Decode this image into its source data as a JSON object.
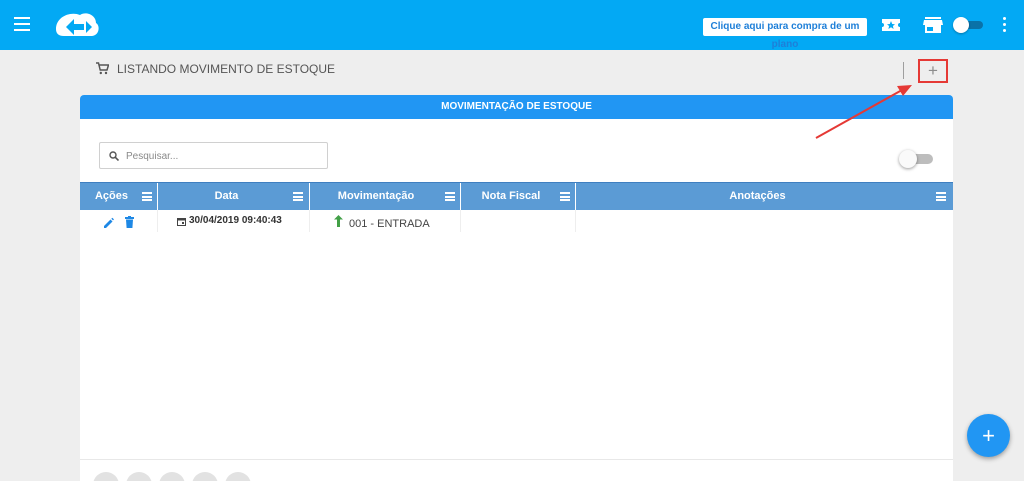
{
  "topbar": {
    "plan_button_label": "Clique aqui para compra de um plano",
    "icons": [
      "menu-icon",
      "logo",
      "ticket-icon",
      "store-icon",
      "toggle",
      "more-vert-icon"
    ],
    "accent_color": "#03a9f4"
  },
  "page": {
    "title": "LISTANDO MOVIMENTO DE ESTOQUE",
    "add_label": "+"
  },
  "card": {
    "header": "MOVIMENTAÇÃO DE ESTOQUE",
    "header_color": "#2196f3",
    "search": {
      "placeholder": "Pesquisar..."
    },
    "toggle_on": false
  },
  "table": {
    "columns": [
      "Ações",
      "Data",
      "Movimentação",
      "Nota Fiscal",
      "Anotações"
    ],
    "rows": [
      {
        "actions": [
          "edit-icon",
          "trash-icon"
        ],
        "data": "30/04/2019 09:40:43",
        "movimentacao": "001 - ENTRADA",
        "nota_fiscal": "",
        "anotacoes": ""
      }
    ]
  },
  "fab": {
    "label": "+"
  },
  "colors": {
    "table_header": "#5b9bd5",
    "highlight_box": "#e53935",
    "arrow": "#e53935",
    "entry_arrow": "#43a047",
    "action_icon": "#1e88e5"
  }
}
